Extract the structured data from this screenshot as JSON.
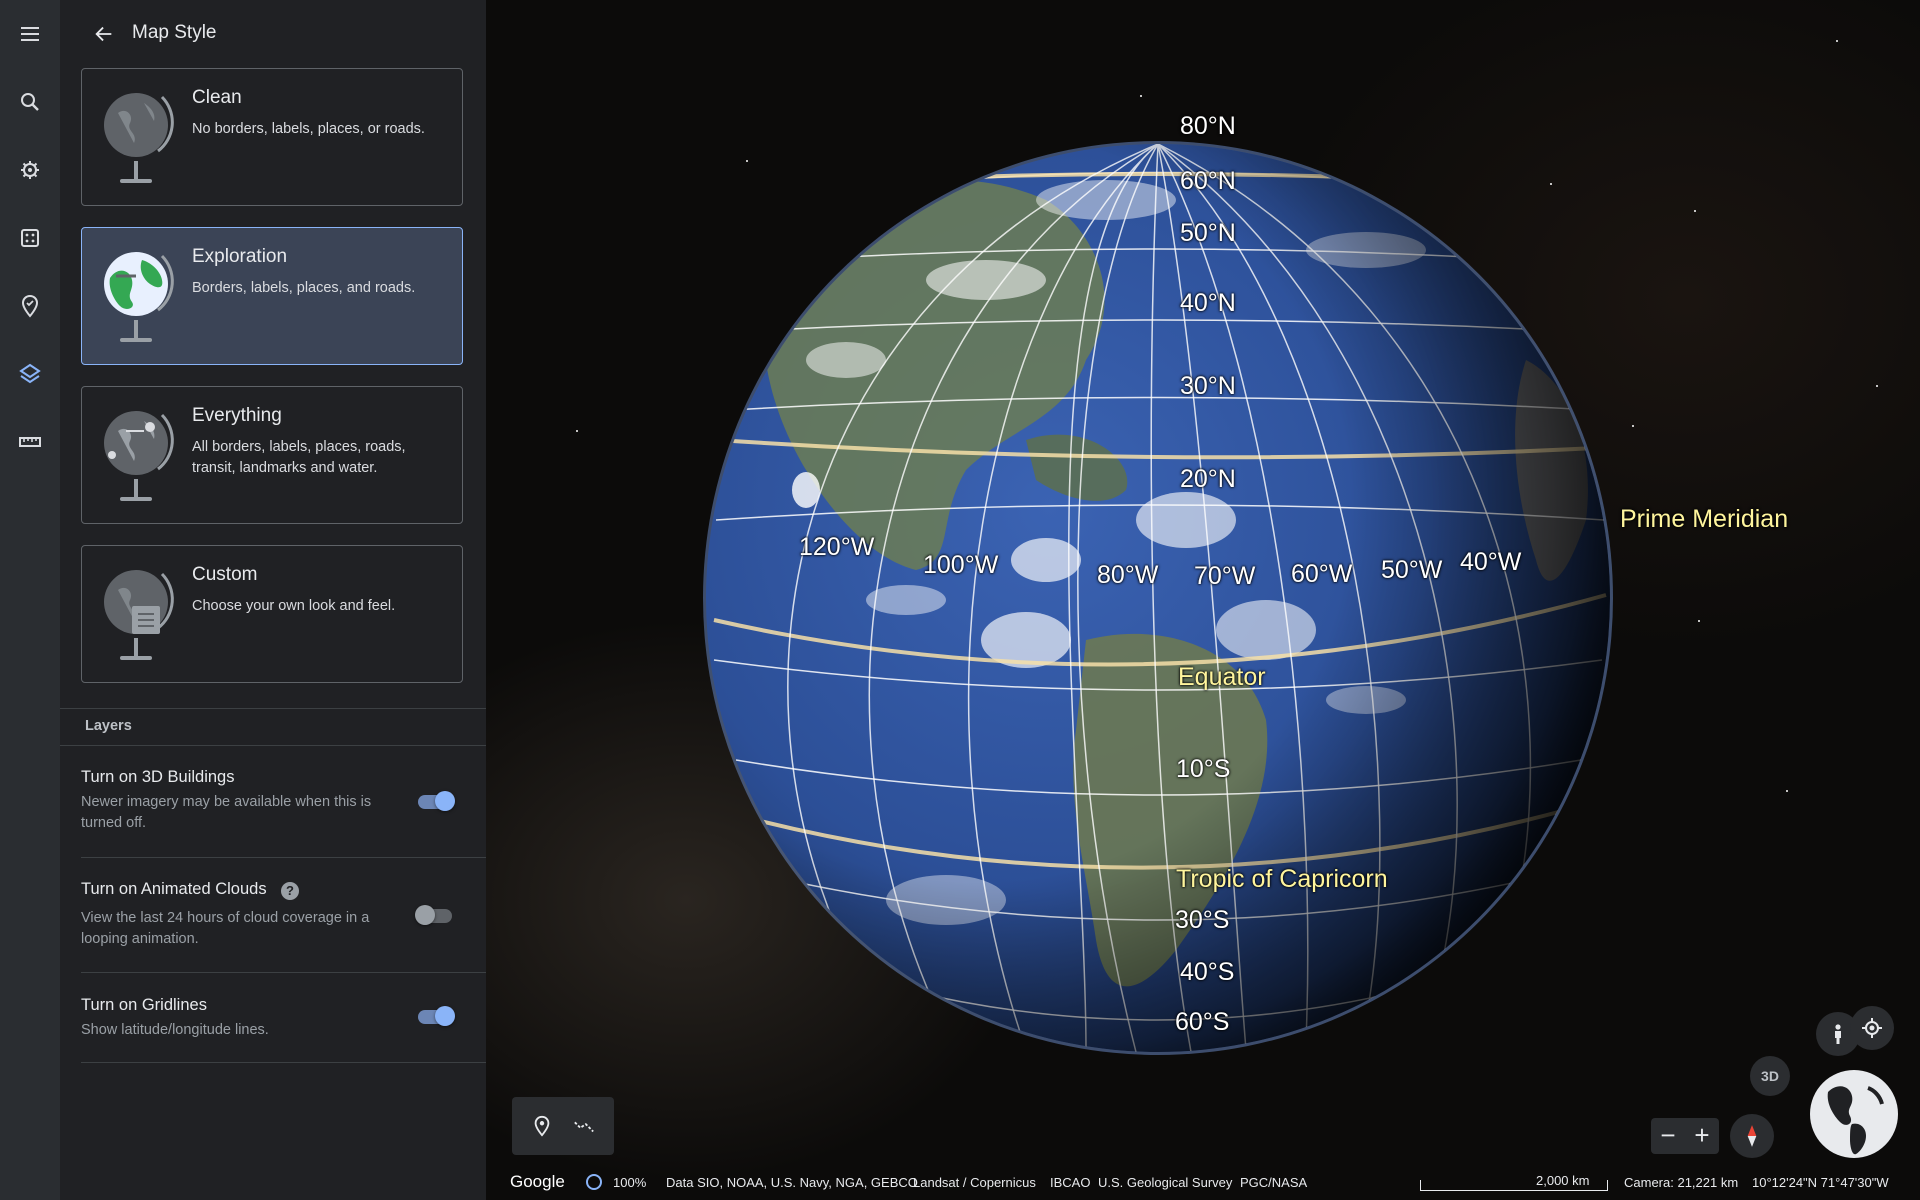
{
  "rail": {
    "items": [
      "menu-icon",
      "search-icon",
      "voyager-icon",
      "dice-icon",
      "projects-icon",
      "layers-icon",
      "ruler-icon"
    ]
  },
  "panel": {
    "title": "Map Style",
    "styles": [
      {
        "title": "Clean",
        "desc": "No borders, labels, places, or roads.",
        "selected": false
      },
      {
        "title": "Exploration",
        "desc": "Borders, labels, places, and roads.",
        "selected": true
      },
      {
        "title": "Everything",
        "desc": "All borders, labels, places, roads, transit, landmarks and water.",
        "selected": false
      },
      {
        "title": "Custom",
        "desc": "Choose your own look and feel.",
        "selected": false
      }
    ],
    "layers_label": "Layers",
    "layers": [
      {
        "title": "Turn on 3D Buildings",
        "desc": "Newer imagery may be available when this is turned off.",
        "on": true
      },
      {
        "title": "Turn on Animated Clouds",
        "desc": "View the last 24 hours of cloud coverage in a looping animation.",
        "on": false,
        "help": "?"
      },
      {
        "title": "Turn on Gridlines",
        "desc": "Show latitude/longitude lines.",
        "on": true
      }
    ]
  },
  "map": {
    "lat_labels": [
      "80°N",
      "60°N",
      "50°N",
      "40°N",
      "30°N",
      "20°N",
      "10°S",
      "30°S",
      "40°S",
      "60°S"
    ],
    "lon_labels": [
      "120°W",
      "100°W",
      "80°W",
      "70°W",
      "60°W",
      "50°W",
      "40°W"
    ],
    "special_labels": {
      "prime_meridian": "Prime Meridian",
      "equator": "Equator",
      "tropic_capricorn": "Tropic of Capricorn"
    },
    "view_3d": "3D",
    "zoom_out": "−",
    "zoom_in": "+"
  },
  "bottom_bar": {
    "brand": "Google",
    "percent": "100%",
    "attribution": [
      "Data SIO, NOAA, U.S. Navy, NGA, GEBCO",
      "Landsat / Copernicus",
      "IBCAO",
      "U.S. Geological Survey",
      "PGC/NASA"
    ],
    "scale": "2,000 km",
    "camera": "Camera: 21,221 km",
    "coords": "10°12'24\"N 71°47'30\"W"
  },
  "colors": {
    "panel": "#202124",
    "rail": "#2a2d31",
    "accent": "#8ab4f8",
    "selected_card": "#3b4456",
    "label_yellow": "#fff59d"
  }
}
